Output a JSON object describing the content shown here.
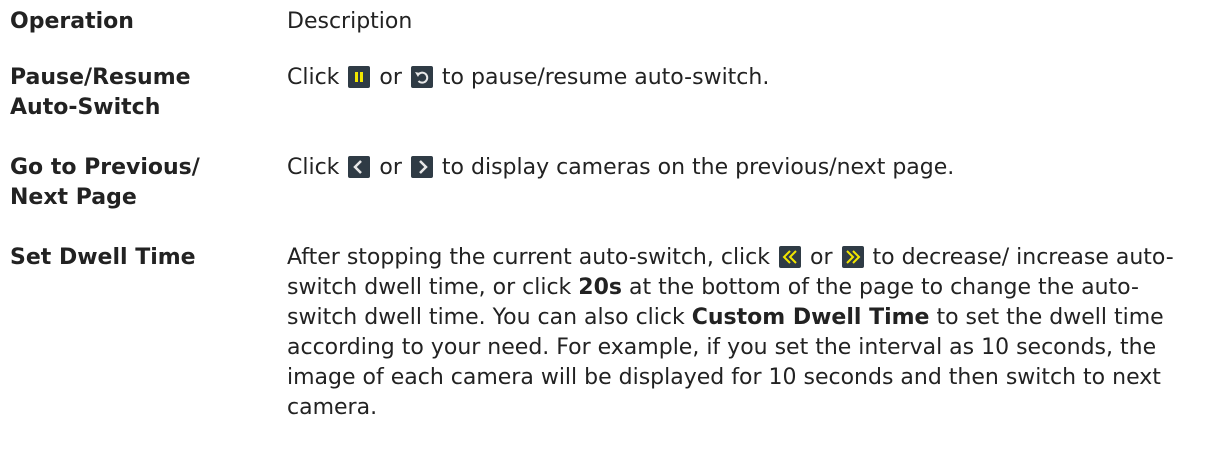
{
  "header": {
    "operation": "Operation",
    "description": "Description"
  },
  "rows": [
    {
      "operation_line1": "Pause/Resume",
      "operation_line2": "Auto-Switch",
      "desc_pre": "Click ",
      "icon1": "pause-icon",
      "desc_or": " or ",
      "icon2": "resume-icon",
      "desc_post": " to pause/resume auto-switch."
    },
    {
      "operation_line1": "Go to Previous/",
      "operation_line2": "Next Page",
      "desc_pre": "Click ",
      "icon1": "chevron-left-icon",
      "desc_or": " or ",
      "icon2": "chevron-right-icon",
      "desc_post": " to display cameras on the previous/next page."
    },
    {
      "operation": "Set Dwell Time",
      "desc_pre": "After stopping the current auto-switch, click ",
      "icon1": "double-chevron-left-icon",
      "desc_or": " or ",
      "icon2": "double-chevron-right-icon",
      "desc_mid1": " to decrease/ increase auto-switch dwell time, or click ",
      "bold1": "20s",
      "desc_mid2": " at the bottom of the page to change the auto-switch dwell time. You can also click ",
      "bold2": "Custom Dwell Time",
      "desc_post": " to set the dwell time according to your need. For example, if you set the interval as 10 seconds, the image of each camera will be displayed for 10 seconds and then switch to next camera."
    }
  ]
}
